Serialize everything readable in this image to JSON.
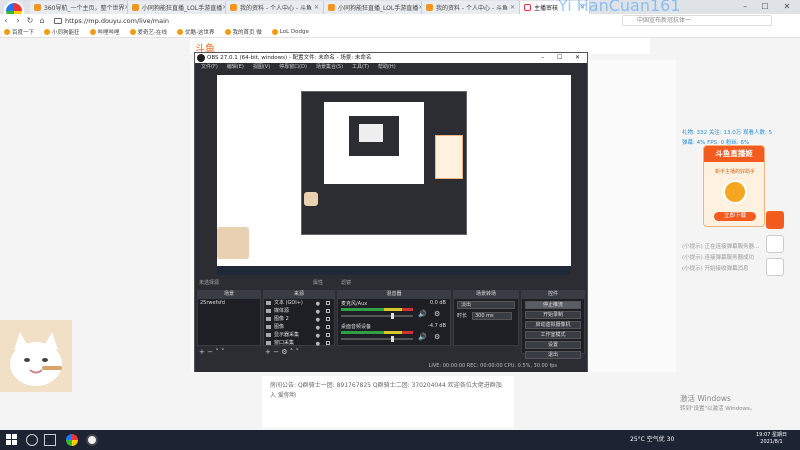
{
  "browser": {
    "tabs": [
      {
        "label": "360导航_一个主页，整个世界"
      },
      {
        "label": "小同狗能狂直播_LOL手游直播"
      },
      {
        "label": "我的资料 - 个人中心 - 斗鱼"
      },
      {
        "label": "小同狗能狂直播_LOL手游直播"
      },
      {
        "label": "我的资料 - 个人中心 - 斗鱼"
      },
      {
        "label": "主播审核"
      }
    ],
    "watermark": "Yi  HanCuan161",
    "url": "https://mp.douyu.com/live/main",
    "search_placeholder": "中国宣布新冠抗体一",
    "bookmarks": [
      "百度一下",
      "小同狗能狂",
      "哔哩哔哩",
      "爱奇艺-在线",
      "优酷-这世界",
      "我的首页 微",
      "LoL Dodge"
    ]
  },
  "obs": {
    "title": "OBS 27.0.1 (64-bit, windows) - 配置文件: 未命名 - 场景: 未命名",
    "menu": [
      "文件(F)",
      "编辑(E)",
      "视图(V)",
      "停靠窗口(D)",
      "场景集合(S)",
      "工具(T)",
      "帮助(H)"
    ],
    "mid_bar": "未选择源",
    "mid_tabs": [
      "属性",
      "滤镜"
    ],
    "docks": {
      "scenes": "场景",
      "sources": "来源",
      "mixer": "混音器",
      "transitions": "场景转场",
      "controls": "控件"
    },
    "scene_item": "25rwefsfd",
    "sources": [
      "文本 (GDI+)",
      "媒体源",
      "图像 2",
      "图像",
      "显示器采集",
      "窗口采集"
    ],
    "mixer": [
      {
        "name": "麦克风/Aux",
        "db": "0.0 dB"
      },
      {
        "name": "桌面音频设备",
        "db": "-4.7 dB"
      }
    ],
    "transition": {
      "value": "淡出",
      "duration_label": "时长",
      "duration": "300 ms"
    },
    "controls": [
      "停止推流",
      "开始录制",
      "启动虚拟摄像机",
      "工作室模式",
      "设置",
      "退出"
    ],
    "status": "LIVE: 00:00:00   REC: 00:00:00   CPU: 0.5%, 30.00 fps"
  },
  "douyu": {
    "nav_brand": "斗鱼",
    "stats": [
      "礼物: 332    关注: 13.0万    观看人数: 5",
      "弹幕: 4%     FPS: 0     粉丝: 6%"
    ],
    "ad": {
      "title": "斗鱼直播姬",
      "subtitle": "新手主播的好助手",
      "button": "立即下载"
    },
    "side_messages": [
      "(小提示) 正在连接弹幕服务器...",
      "(小提示) 连接弹幕服务器成功",
      "(小提示) 开始接收弹幕消息"
    ],
    "announcement_label": "房间公告:",
    "announcement": "Q群骑士一团: 891767825 Q群骑士二团: 370204044 欢迎各位大佬进群加入 爱你哟"
  },
  "windows": {
    "activate_title": "激活 Windows",
    "activate_sub": "转到\"设置\"以激活 Windows。",
    "weather": "25°C  空气优 30",
    "time": "19:07 星期日",
    "date": "2021/8/1"
  }
}
